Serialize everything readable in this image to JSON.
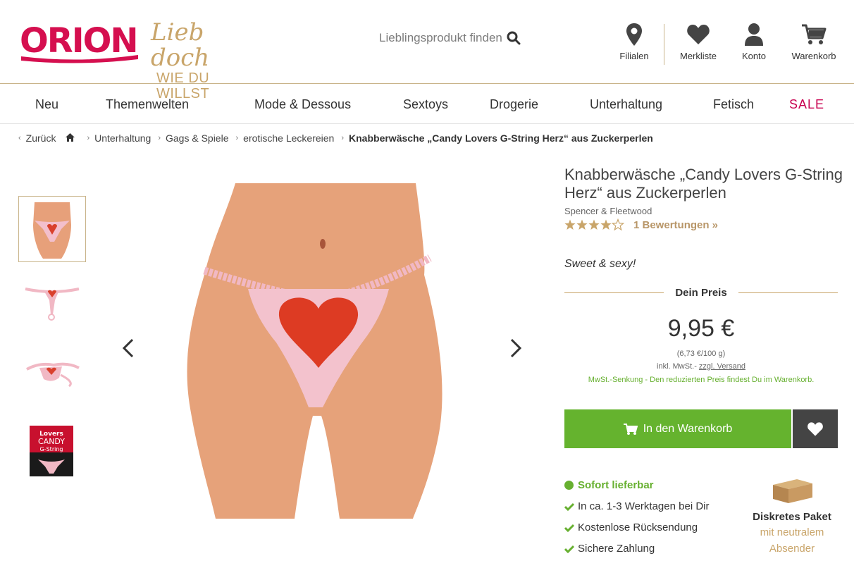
{
  "header": {
    "brand": "ORION",
    "slogan_line1": "Lieb doch",
    "slogan_line2": "WIE DU WILLST",
    "search_placeholder": "Lieblingsprodukt finden",
    "links": [
      {
        "label": "Filialen",
        "icon": "location-pin-icon"
      },
      {
        "label": "Merkliste",
        "icon": "heart-icon"
      },
      {
        "label": "Konto",
        "icon": "user-icon"
      },
      {
        "label": "Warenkorb",
        "icon": "cart-icon"
      }
    ]
  },
  "nav": [
    "Neu",
    "Themenwelten",
    "Mode & Dessous",
    "Sextoys",
    "Drogerie",
    "Unterhaltung",
    "Fetisch",
    "SALE"
  ],
  "breadcrumb": {
    "back": "Zurück",
    "items": [
      "Unterhaltung",
      "Gags & Spiele",
      "erotische Leckereien"
    ],
    "current": "Knabberwäsche „Candy Lovers G-String Herz“ aus Zuckerperlen"
  },
  "product": {
    "title": "Knabberwäsche „Candy Lovers G-String Herz“ aus Zuckerperlen",
    "brand": "Spencer & Fleetwood",
    "rating": 4,
    "rating_max": 5,
    "reviews": "1 Bewertungen »",
    "tagline": "Sweet & sexy!",
    "price_label": "Dein Preis",
    "price": "9,95 €",
    "unit_price": "(6,73 €/100 g)",
    "vat_text": "inkl. MwSt.-",
    "shipping_link": "zzgl. Versand",
    "vat_notice": "MwSt.-Senkung - Den reduzierten Preis findest Du im Warenkorb.",
    "add_to_cart": "In den Warenkorb",
    "availability": "Sofort lieferbar",
    "features": [
      "In ca. 1-3 Werktagen bei Dir",
      "Kostenlose Rücksendung",
      "Sichere Zahlung"
    ],
    "package_title": "Diskretes Paket",
    "package_line1": "mit neutralem",
    "package_line2": "Absender"
  },
  "gallery": {
    "thumb_count": 4,
    "box_text_1": "Lovers",
    "box_text_2": "CANDY",
    "box_text_3": "G-String"
  },
  "colors": {
    "brand_red": "#d50f4f",
    "gold": "#c9a56a",
    "green": "#65b32e",
    "dark": "#444444"
  }
}
